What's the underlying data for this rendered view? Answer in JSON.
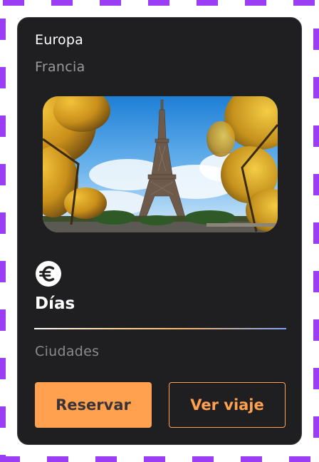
{
  "colors": {
    "dash_border": "#9b3df5",
    "card_background": "#1f1e21",
    "accent": "#ffa14e",
    "text_primary": "#ffffff",
    "text_secondary": "#9a999d"
  },
  "card": {
    "region": "Europa",
    "country": "Francia",
    "image": {
      "subject": "eiffel-tower-photo"
    },
    "currency_icon": "euro-icon",
    "days_label": "Días",
    "cities_label": "Ciudades",
    "buttons": {
      "reserve": "Reservar",
      "view_trip": "Ver viaje"
    }
  }
}
